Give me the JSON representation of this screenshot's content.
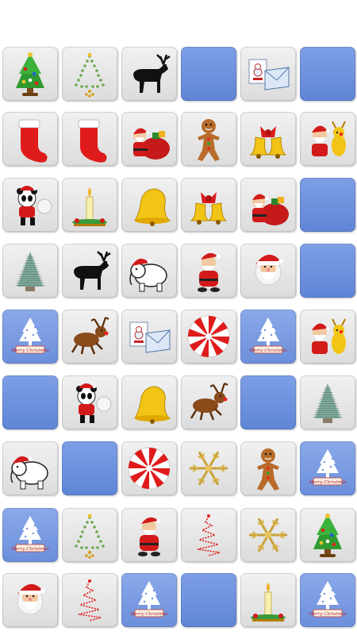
{
  "board": {
    "rows": 9,
    "cols": 6,
    "tiles": [
      [
        "christmas-tree",
        "dotted-tree",
        "reindeer-silhouette",
        "hidden",
        "greeting-card",
        "hidden"
      ],
      [
        "stocking",
        "stocking",
        "santa-sack",
        "gingerbread-man",
        "bells-bow",
        "santa-reindeer"
      ],
      [
        "panda",
        "candle",
        "bell",
        "bells-bow",
        "santa-sack",
        "hidden"
      ],
      [
        "frosted-tree",
        "reindeer-silhouette",
        "elephant",
        "santa-sitting",
        "santa-face",
        "hidden"
      ],
      [
        "snow-tree-card",
        "flying-reindeer",
        "greeting-card",
        "peppermint",
        "snow-tree-card",
        "santa-reindeer"
      ],
      [
        "hidden",
        "panda",
        "bell",
        "flying-reindeer",
        "hidden",
        "frosted-tree"
      ],
      [
        "elephant",
        "hidden",
        "peppermint",
        "snowflake",
        "gingerbread-man",
        "snow-tree-card"
      ],
      [
        "snow-tree-card",
        "dotted-tree",
        "santa-sitting",
        "swirl-tree",
        "snowflake",
        "christmas-tree"
      ],
      [
        "santa-face",
        "swirl-tree",
        "snow-tree-card",
        "hidden",
        "candle",
        "snow-tree-card"
      ]
    ],
    "card_caption": "Merry Christmas"
  },
  "colors": {
    "tile_face": "#e6e6e6",
    "tile_hidden": "#6b8fdc",
    "accent_red": "#e01b1b",
    "accent_green": "#2a8a2a",
    "accent_gold": "#f0b020"
  }
}
